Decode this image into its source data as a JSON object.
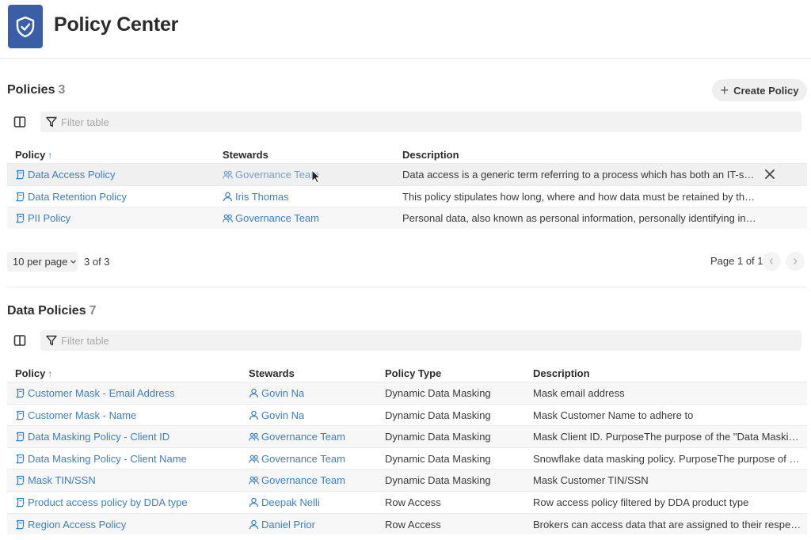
{
  "header": {
    "title": "Policy Center",
    "logo_icon": "shield-check-icon",
    "accent": "#3a5fa8"
  },
  "policies": {
    "title": "Policies",
    "count": "3",
    "create_label": "Create Policy",
    "filter_placeholder": "Filter table",
    "columns": [
      "Policy",
      "Stewards",
      "Description"
    ],
    "rows": [
      {
        "name": "Data Access Policy",
        "steward": "Governance Team",
        "steward_type": "group",
        "description": "Data access is a generic term referring to a process which has both an IT-spec..."
      },
      {
        "name": "Data Retention Policy",
        "steward": "Iris Thomas",
        "steward_type": "user",
        "description": "This policy stipulates how long, where and how data must be retained by the c..."
      },
      {
        "name": "PII Policy",
        "steward": "Governance Team",
        "steward_type": "group",
        "description": "Personal data, also known as personal information, personally identifying infor..."
      }
    ],
    "pager": {
      "per_page": "10 per page",
      "range": "3 of 3",
      "page": "Page 1 of 1"
    }
  },
  "data_policies": {
    "title": "Data Policies",
    "count": "7",
    "filter_placeholder": "Filter table",
    "columns": [
      "Policy",
      "Stewards",
      "Policy Type",
      "Description"
    ],
    "rows": [
      {
        "name": "Customer Mask - Email Address",
        "steward": "Govin Na",
        "steward_type": "user",
        "type": "Dynamic Data Masking",
        "description": "Mask email address"
      },
      {
        "name": "Customer Mask - Name",
        "steward": "Govin Na",
        "steward_type": "user",
        "type": "Dynamic Data Masking",
        "description": "Mask Customer Name to adhere to"
      },
      {
        "name": "Data Masking Policy - Client ID",
        "steward": "Governance Team",
        "steward_type": "group",
        "type": "Dynamic Data Masking",
        "description": "Mask Client ID. PurposeThe purpose of the \"Data Masking..."
      },
      {
        "name": "Data Masking Policy - Client Name",
        "steward": "Governance Team",
        "steward_type": "group",
        "type": "Dynamic Data Masking",
        "description": "Snowflake data masking policy.  PurposeThe purpose of th..."
      },
      {
        "name": "Mask TIN/SSN",
        "steward": "Governance Team",
        "steward_type": "group",
        "type": "Dynamic Data Masking",
        "description": "Mask Customer TIN/SSN"
      },
      {
        "name": "Product access policy by DDA type",
        "steward": "Deepak Nelli",
        "steward_type": "user",
        "type": "Row Access",
        "description": "Row access policy filtered by DDA product type"
      },
      {
        "name": "Region Access Policy",
        "steward": "Daniel Prior",
        "steward_type": "user",
        "type": "Row Access",
        "description": " Brokers can access data that are assigned to their respec..."
      }
    ]
  }
}
